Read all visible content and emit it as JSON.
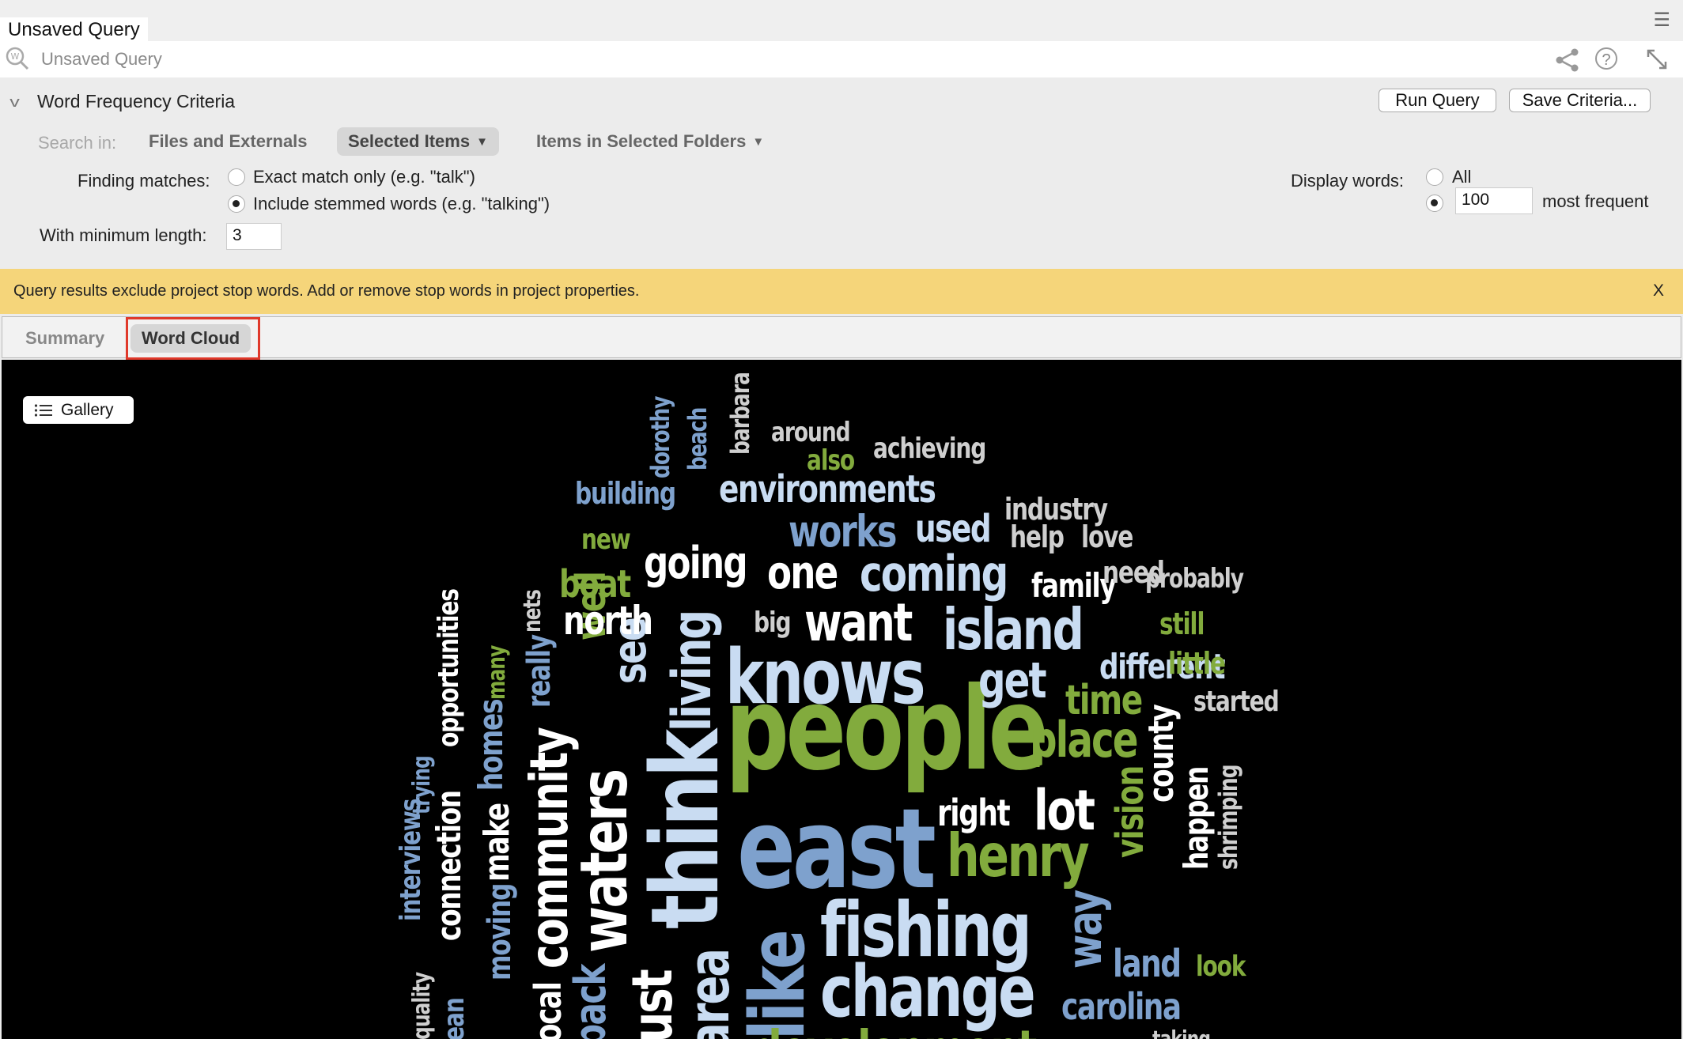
{
  "window": {
    "doc_title": "Unsaved Query",
    "menu_icon": "hamburger-menu-icon"
  },
  "query_bar": {
    "name_placeholder": "Unsaved Query",
    "icons": [
      "word-query-icon",
      "share-icon",
      "help-icon",
      "expand-icon"
    ],
    "help_glyph": "?"
  },
  "criteria": {
    "title": "Word Frequency Criteria",
    "run_label": "Run Query",
    "save_label": "Save Criteria...",
    "search_in_label": "Search in:",
    "scopes": [
      {
        "label": "Files and Externals",
        "selected": false
      },
      {
        "label": "Selected Items",
        "selected": true
      },
      {
        "label": "Items in Selected Folders",
        "selected": false
      }
    ],
    "finding_label": "Finding matches:",
    "exact_label": "Exact match only (e.g. \"talk\")",
    "stemmed_label": "Include stemmed words (e.g. \"talking\")",
    "match_mode": "stemmed",
    "min_length_label": "With minimum length:",
    "min_length": "3",
    "display_label": "Display words:",
    "all_label": "All",
    "top_count": "100",
    "most_frequent_label": "most frequent",
    "display_mode": "top"
  },
  "banner": {
    "text": "Query results exclude project stop words. Add or remove stop words in project properties.",
    "close": "X",
    "color": "#f5d57a"
  },
  "tabs": [
    {
      "label": "Summary",
      "active": false
    },
    {
      "label": "Word Cloud",
      "active": true
    }
  ],
  "gallery": {
    "label": "Gallery"
  },
  "palette": {
    "white": "#ffffff",
    "pale_blue": "#c9dcf2",
    "blue": "#7ea1cd",
    "green": "#82ab3d",
    "gray": "#cfcfcf"
  },
  "word_cloud": {
    "words": [
      "people",
      "east",
      "knows",
      "think",
      "fishing",
      "change",
      "waters",
      "like",
      "henry",
      "island",
      "living",
      "want",
      "community",
      "coming",
      "lot",
      "place",
      "get",
      "area",
      "works",
      "going",
      "one",
      "environments",
      "see",
      "way",
      "well",
      "time",
      "vision",
      "north",
      "used",
      "just",
      "boat",
      "land",
      "carolina",
      "county",
      "connection",
      "right",
      "make",
      "homes",
      "really",
      "happen",
      "different",
      "opportunities",
      "development",
      "industry",
      "family",
      "interviews",
      "back",
      "shrimping",
      "started",
      "little",
      "still",
      "building",
      "moving",
      "need",
      "probably",
      "help",
      "love",
      "achieving",
      "around",
      "also",
      "new",
      "big",
      "beach",
      "barbara",
      "dorothy",
      "many",
      "nets",
      "trying",
      "quality",
      "mean",
      "look",
      "local",
      "taking"
    ]
  }
}
